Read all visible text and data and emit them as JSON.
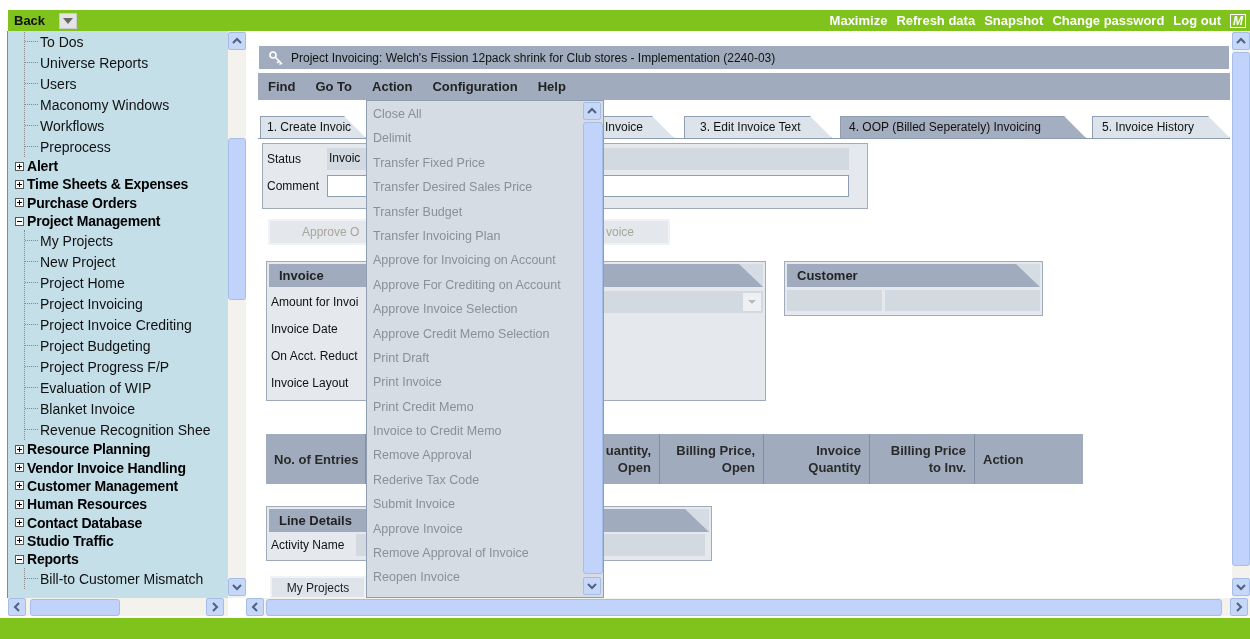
{
  "top_bar": {
    "back": "Back",
    "links": [
      "Maximize",
      "Refresh data",
      "Snapshot",
      "Change password",
      "Log out"
    ],
    "logo": "M"
  },
  "sidebar": {
    "items": [
      {
        "label": "To Dos",
        "kind": "leaf"
      },
      {
        "label": "Universe Reports",
        "kind": "leaf"
      },
      {
        "label": "Users",
        "kind": "leaf"
      },
      {
        "label": "Maconomy Windows",
        "kind": "leaf"
      },
      {
        "label": "Workflows",
        "kind": "leaf"
      },
      {
        "label": "Preprocess",
        "kind": "leaf"
      },
      {
        "label": "Alert",
        "kind": "group",
        "expanded": false
      },
      {
        "label": "Time Sheets & Expenses",
        "kind": "group",
        "expanded": false
      },
      {
        "label": "Purchase Orders",
        "kind": "group",
        "expanded": false
      },
      {
        "label": "Project Management",
        "kind": "group",
        "expanded": true,
        "children": [
          {
            "label": "My Projects"
          },
          {
            "label": "New Project"
          },
          {
            "label": "Project Home"
          },
          {
            "label": "Project Invoicing"
          },
          {
            "label": "Project Invoice Crediting"
          },
          {
            "label": "Project Budgeting"
          },
          {
            "label": "Project Progress F/P"
          },
          {
            "label": "Evaluation of WIP"
          },
          {
            "label": "Blanket Invoice"
          },
          {
            "label": "Revenue Recognition Shee"
          }
        ]
      },
      {
        "label": "Resource Planning",
        "kind": "group",
        "expanded": false
      },
      {
        "label": "Vendor Invoice Handling",
        "kind": "group",
        "expanded": false
      },
      {
        "label": "Customer Management",
        "kind": "group",
        "expanded": false
      },
      {
        "label": "Human Resources",
        "kind": "group",
        "expanded": false
      },
      {
        "label": "Contact Database",
        "kind": "group",
        "expanded": false
      },
      {
        "label": "Studio Traffic",
        "kind": "group",
        "expanded": false
      },
      {
        "label": "Reports",
        "kind": "group",
        "expanded": true,
        "children": [
          {
            "label": "Bill-to Customer Mismatch"
          }
        ]
      }
    ]
  },
  "window": {
    "title": "Project Invoicing: Welch's Fission 12pack shrink for Club stores - Implementation (2240-03)",
    "menu": [
      "Find",
      "Go To",
      "Action",
      "Configuration",
      "Help"
    ]
  },
  "action_menu": {
    "items": [
      {
        "label": "Close All",
        "disabled": true
      },
      {
        "label": "Delimit",
        "disabled": true
      },
      {
        "label": "Transfer Fixed Price",
        "disabled": true
      },
      {
        "label": "Transfer Desired Sales Price",
        "disabled": true
      },
      {
        "label": "Transfer Budget",
        "disabled": true
      },
      {
        "label": "Transfer Invoicing Plan",
        "disabled": true
      },
      {
        "label": "Approve for Invoicing on Account",
        "disabled": true
      },
      {
        "label": "Approve For Crediting on Account",
        "disabled": true
      },
      {
        "label": "Approve Invoice Selection",
        "disabled": true
      },
      {
        "label": "Approve Credit Memo Selection",
        "disabled": true
      },
      {
        "label": "Print Draft",
        "disabled": true
      },
      {
        "label": "Print Invoice",
        "disabled": true
      },
      {
        "label": "Print Credit Memo",
        "disabled": true
      },
      {
        "label": "Invoice to Credit Memo",
        "disabled": true
      },
      {
        "label": "Remove Approval",
        "disabled": true
      },
      {
        "label": "Rederive Tax Code",
        "disabled": true
      },
      {
        "label": "Submit Invoice",
        "disabled": true
      },
      {
        "label": "Approve Invoice",
        "disabled": true
      },
      {
        "label": "Remove Approval of Invoice",
        "disabled": true
      },
      {
        "label": "Reopen Invoice",
        "disabled": true
      }
    ]
  },
  "tabs": [
    {
      "label": "1. Create Invoic",
      "selected": false
    },
    {
      "label": "Invoice",
      "selected": false
    },
    {
      "label": "3. Edit Invoice Text",
      "selected": false
    },
    {
      "label": "4. OOP (Billed Seperately) Invoicing",
      "selected": true
    },
    {
      "label": "5. Invoice History",
      "selected": false
    }
  ],
  "status_panel": {
    "status_label": "Status",
    "status_value": "Invoic",
    "comment_label": "Comment"
  },
  "buttons": [
    {
      "label": "Approve O",
      "disabled": true
    },
    {
      "label": "voice",
      "disabled": true
    }
  ],
  "invoice_panel": {
    "title": "Invoice",
    "fields": [
      "Amount for Invoi",
      "Invoice Date",
      "On Acct. Reduct",
      "Invoice Layout"
    ]
  },
  "customer_panel": {
    "title": "Customer"
  },
  "table": {
    "columns": [
      [
        "No. of Entries"
      ],
      [],
      [
        "uantity,",
        "Open"
      ],
      [
        "Billing Price,",
        "Open"
      ],
      [
        "Invoice",
        "Quantity"
      ],
      [
        "Billing Price",
        "to Inv."
      ],
      [
        "Action"
      ]
    ]
  },
  "line_details": {
    "title": "Line Details",
    "field_label": "Activity Name"
  },
  "bottom_button": "My Projects"
}
